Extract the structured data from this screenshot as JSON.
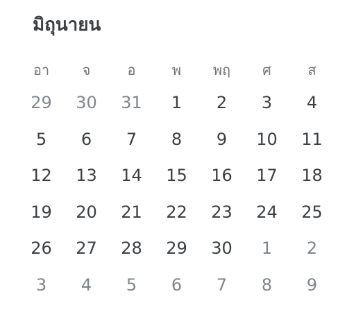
{
  "calendar": {
    "month_title": "มิถุนายน",
    "weekdays": [
      "อา",
      "จ",
      "อ",
      "พ",
      "พฤ",
      "ศ",
      "ส"
    ],
    "weeks": [
      [
        {
          "d": "29",
          "o": true
        },
        {
          "d": "30",
          "o": true
        },
        {
          "d": "31",
          "o": true
        },
        {
          "d": "1",
          "o": false
        },
        {
          "d": "2",
          "o": false
        },
        {
          "d": "3",
          "o": false
        },
        {
          "d": "4",
          "o": false
        }
      ],
      [
        {
          "d": "5",
          "o": false
        },
        {
          "d": "6",
          "o": false
        },
        {
          "d": "7",
          "o": false
        },
        {
          "d": "8",
          "o": false
        },
        {
          "d": "9",
          "o": false
        },
        {
          "d": "10",
          "o": false
        },
        {
          "d": "11",
          "o": false
        }
      ],
      [
        {
          "d": "12",
          "o": false
        },
        {
          "d": "13",
          "o": false
        },
        {
          "d": "14",
          "o": false
        },
        {
          "d": "15",
          "o": false
        },
        {
          "d": "16",
          "o": false
        },
        {
          "d": "17",
          "o": false
        },
        {
          "d": "18",
          "o": false
        }
      ],
      [
        {
          "d": "19",
          "o": false
        },
        {
          "d": "20",
          "o": false
        },
        {
          "d": "21",
          "o": false
        },
        {
          "d": "22",
          "o": false
        },
        {
          "d": "23",
          "o": false
        },
        {
          "d": "24",
          "o": false
        },
        {
          "d": "25",
          "o": false
        }
      ],
      [
        {
          "d": "26",
          "o": false
        },
        {
          "d": "27",
          "o": false
        },
        {
          "d": "28",
          "o": false
        },
        {
          "d": "29",
          "o": false
        },
        {
          "d": "30",
          "o": false
        },
        {
          "d": "1",
          "o": true
        },
        {
          "d": "2",
          "o": true
        }
      ],
      [
        {
          "d": "3",
          "o": true
        },
        {
          "d": "4",
          "o": true
        },
        {
          "d": "5",
          "o": true
        },
        {
          "d": "6",
          "o": true
        },
        {
          "d": "7",
          "o": true
        },
        {
          "d": "8",
          "o": true
        },
        {
          "d": "9",
          "o": true
        }
      ]
    ]
  }
}
